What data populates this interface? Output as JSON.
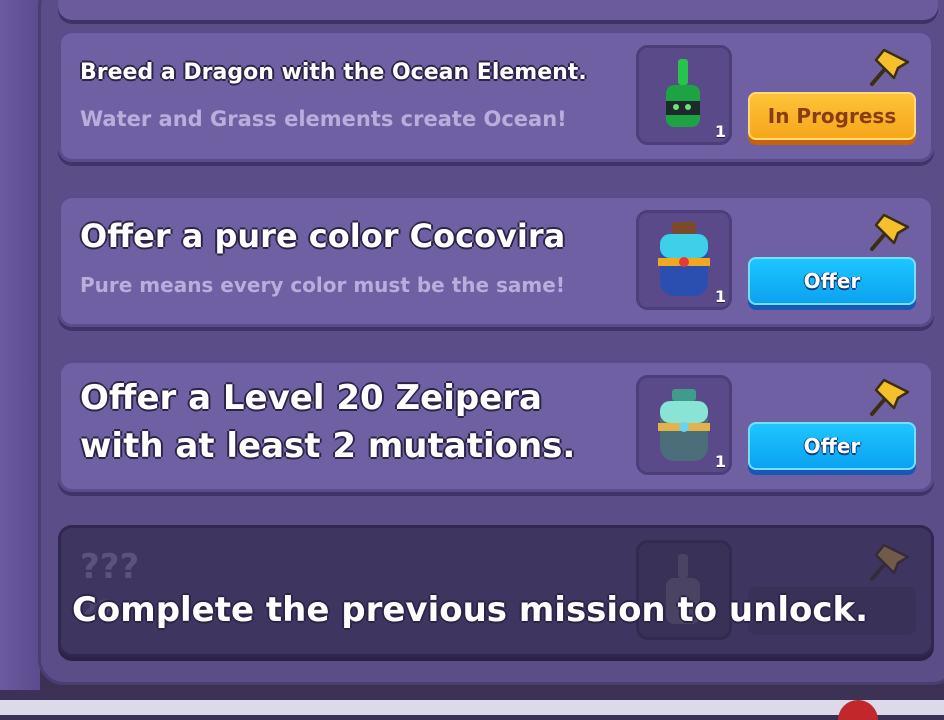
{
  "missions": [
    {
      "title": "Breed a Dragon with the Ocean Element.",
      "subtitle": "Water and Grass elements create Ocean!",
      "item_count": "1",
      "item_icon": "bottle-icon",
      "button_label": "In Progress",
      "button_state": "in-progress"
    },
    {
      "title": "Offer a pure color Cocovira",
      "subtitle": "Pure means every color must be the same!",
      "item_count": "1",
      "item_icon": "potion-jar-icon",
      "button_label": "Offer",
      "button_state": "offer"
    },
    {
      "title_line1": "Offer a Level 20 Zeipera",
      "title_line2": "with at least 2 mutations.",
      "item_count": "1",
      "item_icon": "potion-jar-icon",
      "button_label": "Offer",
      "button_state": "offer"
    },
    {
      "title": "???",
      "subtitle": "??",
      "locked_message": "Complete the previous mission to unlock.",
      "item_icon": "locked-item-icon",
      "button_state": "locked"
    }
  ],
  "colors": {
    "panel": "#5b4d88",
    "card": "#6f60a3",
    "in_progress_button": "#f5a51a",
    "offer_button": "#0aa0f0",
    "pin": "#f6c02c"
  }
}
